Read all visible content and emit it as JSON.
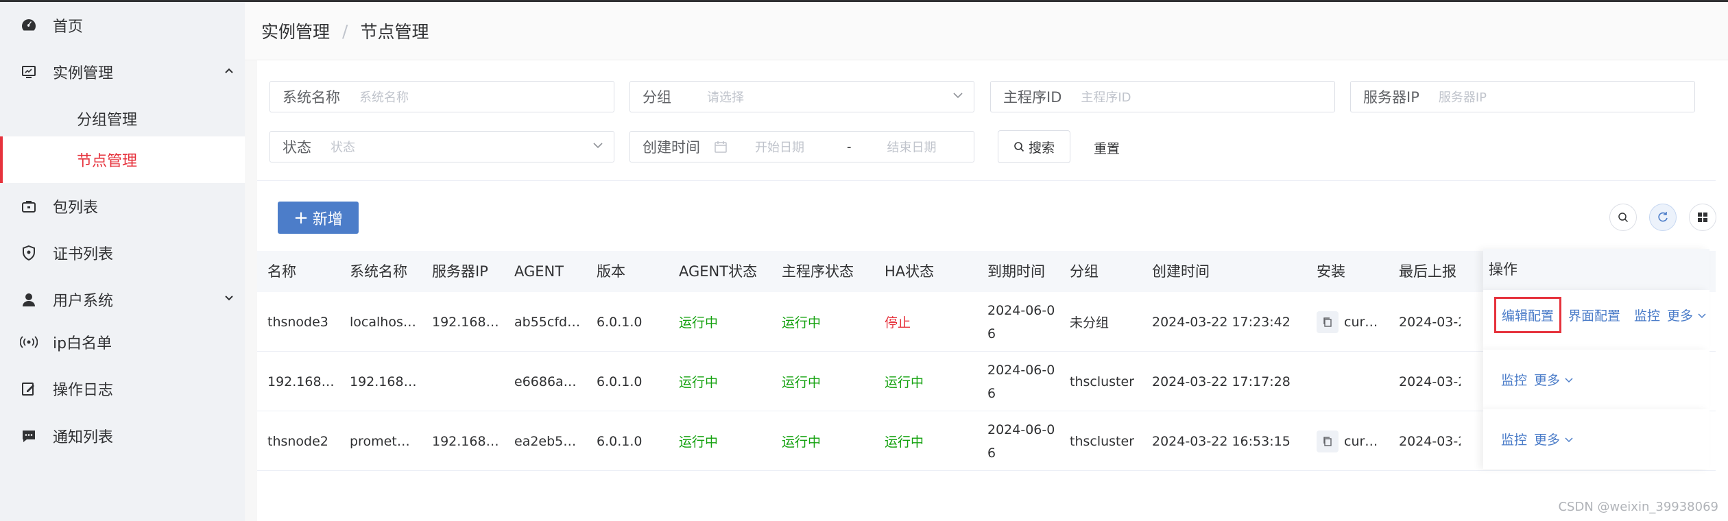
{
  "sidebar": {
    "items": [
      {
        "label": "首页",
        "icon": "dashboard-icon"
      },
      {
        "label": "实例管理",
        "icon": "monitor-icon",
        "expanded": true
      },
      {
        "label": "分组管理"
      },
      {
        "label": "节点管理",
        "active": true
      },
      {
        "label": "包列表",
        "icon": "briefcase-icon"
      },
      {
        "label": "证书列表",
        "icon": "shield-icon"
      },
      {
        "label": "用户系统",
        "icon": "user-icon"
      },
      {
        "label": "ip白名单",
        "icon": "signal-icon"
      },
      {
        "label": "操作日志",
        "icon": "edit-icon"
      },
      {
        "label": "通知列表",
        "icon": "message-icon"
      }
    ]
  },
  "breadcrumb": {
    "first": "实例管理",
    "separator": "/",
    "second": "节点管理"
  },
  "filters": {
    "system_name": {
      "label": "系统名称",
      "placeholder": "系统名称"
    },
    "group": {
      "label": "分组",
      "placeholder": "请选择"
    },
    "main_program_id": {
      "label": "主程序ID",
      "placeholder": "主程序ID"
    },
    "server_ip": {
      "label": "服务器IP",
      "placeholder": "服务器IP"
    },
    "status": {
      "label": "状态",
      "placeholder": "状态"
    },
    "created_time": {
      "label": "创建时间",
      "start": "开始日期",
      "dash": "-",
      "end": "结束日期"
    },
    "search_label": "搜索",
    "reset_label": "重置"
  },
  "toolbar": {
    "add_label": "新增"
  },
  "table": {
    "headers": [
      "名称",
      "系统名称",
      "服务器IP",
      "AGENT",
      "版本",
      "AGENT状态",
      "主程序状态",
      "HA状态",
      "到期时间",
      "分组",
      "创建时间",
      "安装",
      "最后上报",
      "操作"
    ],
    "rows": [
      {
        "name": "thsnode3",
        "system": "localhos…",
        "ip": "192.168…",
        "agent": "ab55cfd…",
        "version": "6.0.1.0",
        "agent_status": "运行中",
        "main_status": "运行中",
        "ha_status": "停止",
        "ha_color": "red",
        "expire_a": "2024-06-0",
        "expire_b": "6",
        "group": "未分组",
        "created": "2024-03-22 17:23:42",
        "install": "cur…",
        "last_report": "2024-03-2",
        "ops": [
          "编辑配置",
          "界面配置",
          "监控",
          "更多"
        ]
      },
      {
        "name": "192.168…",
        "system": "192.168…",
        "ip": "",
        "agent": "e6686a…",
        "version": "6.0.1.0",
        "agent_status": "运行中",
        "main_status": "运行中",
        "ha_status": "运行中",
        "ha_color": "green",
        "expire_a": "2024-06-0",
        "expire_b": "6",
        "group": "thscluster",
        "created": "2024-03-22 17:17:28",
        "install": "",
        "last_report": "2024-03-2",
        "ops": [
          "监控",
          "更多"
        ]
      },
      {
        "name": "thsnode2",
        "system": "promet…",
        "ip": "192.168…",
        "agent": "ea2eb5…",
        "version": "6.0.1.0",
        "agent_status": "运行中",
        "main_status": "运行中",
        "ha_status": "运行中",
        "ha_color": "green",
        "expire_a": "2024-06-0",
        "expire_b": "6",
        "group": "thscluster",
        "created": "2024-03-22 16:53:15",
        "install": "cur…",
        "last_report": "2024-03-2",
        "ops": [
          "监控",
          "更多"
        ]
      }
    ]
  },
  "watermark": "CSDN @weixin_39938069",
  "colors": {
    "primary": "#4c7dc9",
    "danger": "#e6323c",
    "success": "#13a10e"
  }
}
